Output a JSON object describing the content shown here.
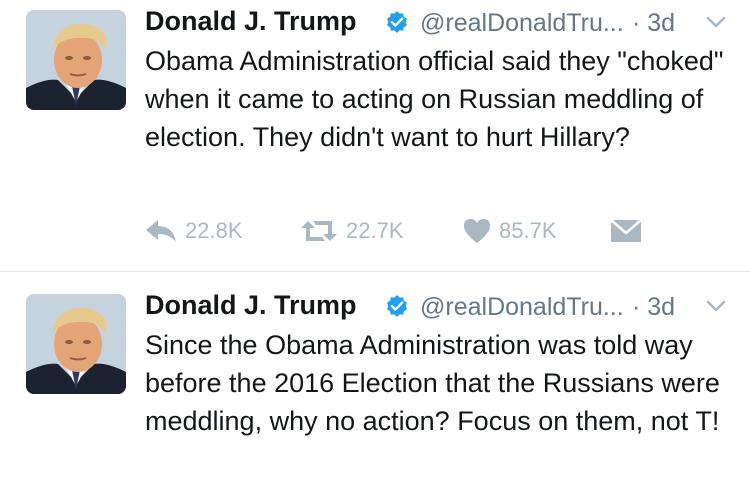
{
  "tweets": [
    {
      "display_name": "Donald J. Trump",
      "handle": "@realDonaldTru...",
      "time": "· 3d",
      "text": "Obama Administration official said they \"choked\" when it came to acting on Russian meddling of election. They didn't want to hurt Hillary?",
      "replies": "22.8K",
      "retweets": "22.7K",
      "likes": "85.7K"
    },
    {
      "display_name": "Donald J. Trump",
      "handle": "@realDonaldTru...",
      "time": "· 3d",
      "text": "Since the Obama Administration was told way before the 2016 Election that the Russians were meddling, why no action? Focus on them, not T!"
    }
  ],
  "colors": {
    "text": "#14171a",
    "muted": "#657786",
    "action_gray": "#aab8c2",
    "verified_blue": "#1da1f2",
    "divider": "#e1e8ed"
  },
  "icons": [
    "reply-icon",
    "retweet-icon",
    "like-icon",
    "direct-message-icon",
    "verified-badge-icon",
    "chevron-down-icon"
  ]
}
